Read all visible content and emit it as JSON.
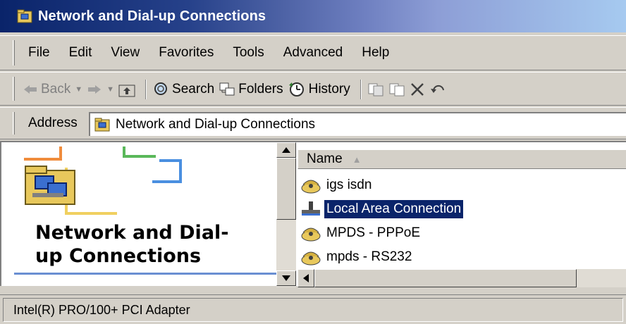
{
  "window": {
    "title": "Network and Dial-up Connections"
  },
  "menu": [
    "File",
    "Edit",
    "View",
    "Favorites",
    "Tools",
    "Advanced",
    "Help"
  ],
  "toolbar": {
    "back": "Back",
    "search": "Search",
    "folders": "Folders",
    "history": "History"
  },
  "address": {
    "label": "Address",
    "value": "Network and Dial-up Connections"
  },
  "left_pane": {
    "heading_line1": "Network and Dial-",
    "heading_line2": "up Connections"
  },
  "list": {
    "column": "Name",
    "items": [
      {
        "name": "igs isdn",
        "icon": "dialup-connection-icon"
      },
      {
        "name": "Local Area Connection",
        "icon": "lan-connection-icon",
        "selected": true
      },
      {
        "name": "MPDS - PPPoE",
        "icon": "dialup-connection-icon"
      },
      {
        "name": "mpds - RS232",
        "icon": "dialup-connection-icon"
      }
    ]
  },
  "status": {
    "text": "Intel(R) PRO/100+ PCI Adapter"
  },
  "colors": {
    "title_active": "#0a246a",
    "selection": "#0a246a",
    "face": "#d4d0c8"
  }
}
